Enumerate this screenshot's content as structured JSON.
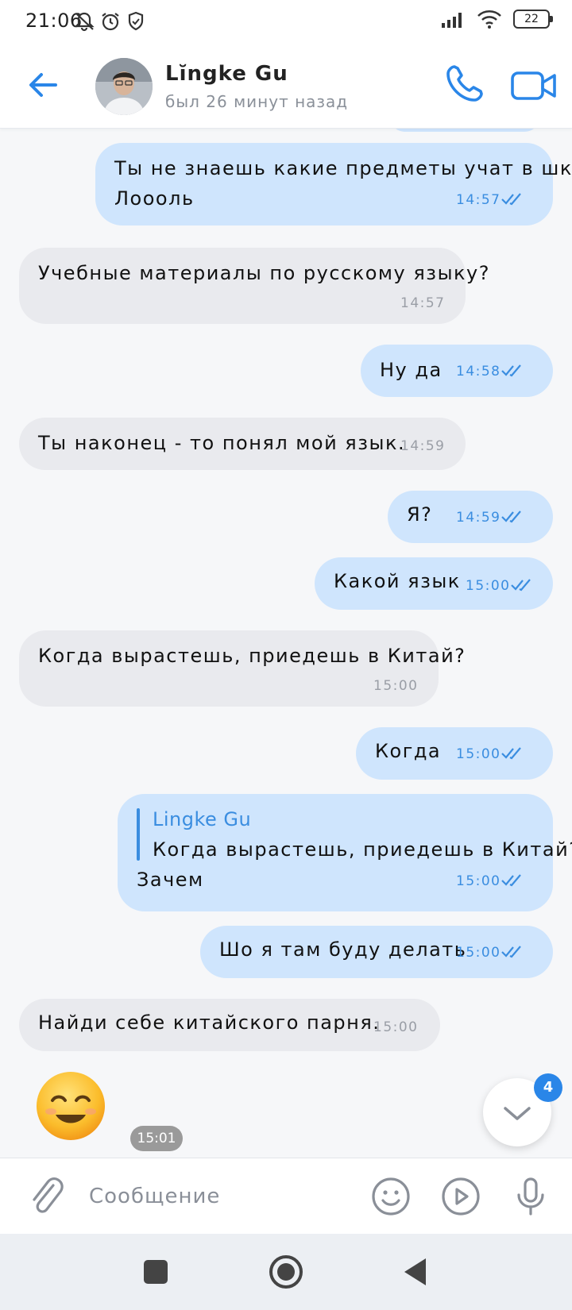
{
  "status_bar": {
    "time": "21:06",
    "battery": "22"
  },
  "header": {
    "contact_name": "Lĭngke Gu",
    "last_seen": "был 26 минут назад"
  },
  "messages": [
    {
      "direction": "out",
      "text_line1": "Ты не знаешь какие предметы учат в шк?",
      "text_line2": "Лоооль",
      "time": "14:57"
    },
    {
      "direction": "in",
      "text": "Учебные материалы по русскому языку?",
      "time": "14:57"
    },
    {
      "direction": "out",
      "text": "Ну да",
      "time": "14:58"
    },
    {
      "direction": "in",
      "text": "Ты наконец - то понял мой язык.",
      "time": "14:59"
    },
    {
      "direction": "out",
      "text": "Я?",
      "time": "14:59"
    },
    {
      "direction": "out",
      "text": "Какой язык",
      "time": "15:00"
    },
    {
      "direction": "in",
      "text": "Когда вырастешь, приедешь в Китай?",
      "time": "15:00"
    },
    {
      "direction": "out",
      "text": "Когда",
      "time": "15:00"
    },
    {
      "direction": "out",
      "reply_to_name": "Lingke Gu",
      "reply_to_text": "Когда вырастешь, приедешь в Китай?",
      "text": "Зачем",
      "time": "15:00"
    },
    {
      "direction": "out",
      "text": "Шо я там буду делать",
      "time": "15:00"
    },
    {
      "direction": "in",
      "text": "Найди себе китайского парня.",
      "time": "15:00"
    },
    {
      "direction": "in",
      "sticker": "smiling-face-emoji",
      "time": "15:01"
    }
  ],
  "unread_badge": "4",
  "composer": {
    "placeholder": "Сообщение"
  },
  "colors": {
    "accent": "#2a86e8",
    "outgoing_bubble": "#cfe5fd",
    "incoming_bubble": "#e9eaee"
  },
  "icons": [
    "back-arrow-icon",
    "phone-icon",
    "video-camera-icon",
    "double-check-icon",
    "chevron-down-icon",
    "paperclip-icon",
    "emoji-icon",
    "play-icon",
    "microphone-icon",
    "nav-square-icon",
    "nav-circle-icon",
    "nav-back-triangle-icon"
  ]
}
